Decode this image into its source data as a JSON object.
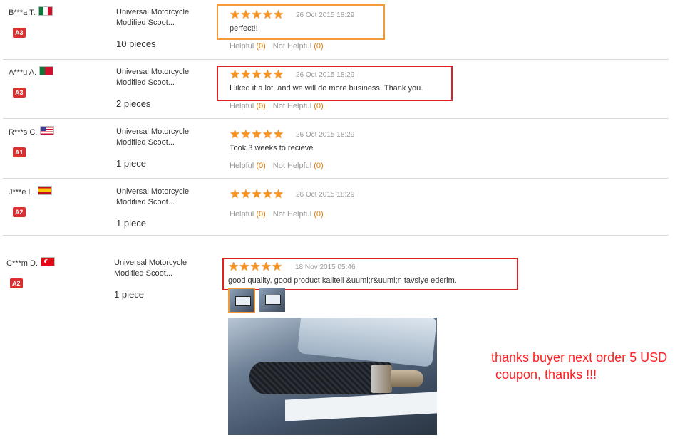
{
  "reviews": [
    {
      "buyer": "B***a T.",
      "flag": "mexico-flag",
      "level": "A3",
      "product": [
        "Universal Motorcycle",
        "Modified Scoot..."
      ],
      "quantity": "10 pieces",
      "rating": 5,
      "stars": "★★★★★",
      "date": "26 Oct 2015 18:29",
      "comment": "perfect!!",
      "highlight": "#f39b3a",
      "helpful_label": "Helpful",
      "helpful_count": "(0)",
      "not_helpful_label": "Not Helpful",
      "not_helpful_count": "(0)"
    },
    {
      "buyer": "A***u A.",
      "flag": "portugal-flag",
      "level": "A3",
      "product": [
        "Universal Motorcycle",
        "Modified Scoot..."
      ],
      "quantity": "2 pieces",
      "rating": 5,
      "stars": "★★★★★",
      "date": "26 Oct 2015 18:29",
      "comment": "I liked it a lot. and we will do more business. Thank you.",
      "highlight": "#e02020",
      "helpful_label": "Helpful",
      "helpful_count": "(0)",
      "not_helpful_label": "Not Helpful",
      "not_helpful_count": "(0)"
    },
    {
      "buyer": "R***s C.",
      "flag": "usa-flag",
      "level": "A1",
      "product": [
        "Universal Motorcycle",
        "Modified Scoot..."
      ],
      "quantity": "1 piece",
      "rating": 5,
      "stars": "★★★★★",
      "date": "26 Oct 2015 18:29",
      "comment": "Took 3 weeks to recieve",
      "highlight": "",
      "helpful_label": "Helpful",
      "helpful_count": "(0)",
      "not_helpful_label": "Not Helpful",
      "not_helpful_count": "(0)"
    },
    {
      "buyer": "J***e L.",
      "flag": "spain-flag",
      "level": "A2",
      "product": [
        "Universal Motorcycle",
        "Modified Scoot..."
      ],
      "quantity": "1 piece",
      "rating": 5,
      "stars": "★★★★★",
      "date": "26 Oct 2015 18:29",
      "comment": "",
      "highlight": "",
      "helpful_label": "Helpful",
      "helpful_count": "(0)",
      "not_helpful_label": "Not Helpful",
      "not_helpful_count": "(0)"
    },
    {
      "buyer": "C***m D.",
      "flag": "turkey-flag",
      "level": "A2",
      "product": [
        "Universal Motorcycle",
        "Modified Scoot..."
      ],
      "quantity": "1 piece",
      "rating": 5,
      "stars": "★★★★★",
      "date": "18 Nov 2015 05:46",
      "comment": "good quality, good product kaliteli &uuml;r&uuml;n tavsiye ederim.",
      "highlight": "#e02020"
    }
  ],
  "seller_note": [
    "thanks buyer next order 5 USD",
    "coupon, thanks !!!"
  ],
  "colors": {
    "star": "#f7931e",
    "helpful_count": "#e07b00",
    "level_badge": "#d9302f",
    "note": "#ff2020"
  }
}
